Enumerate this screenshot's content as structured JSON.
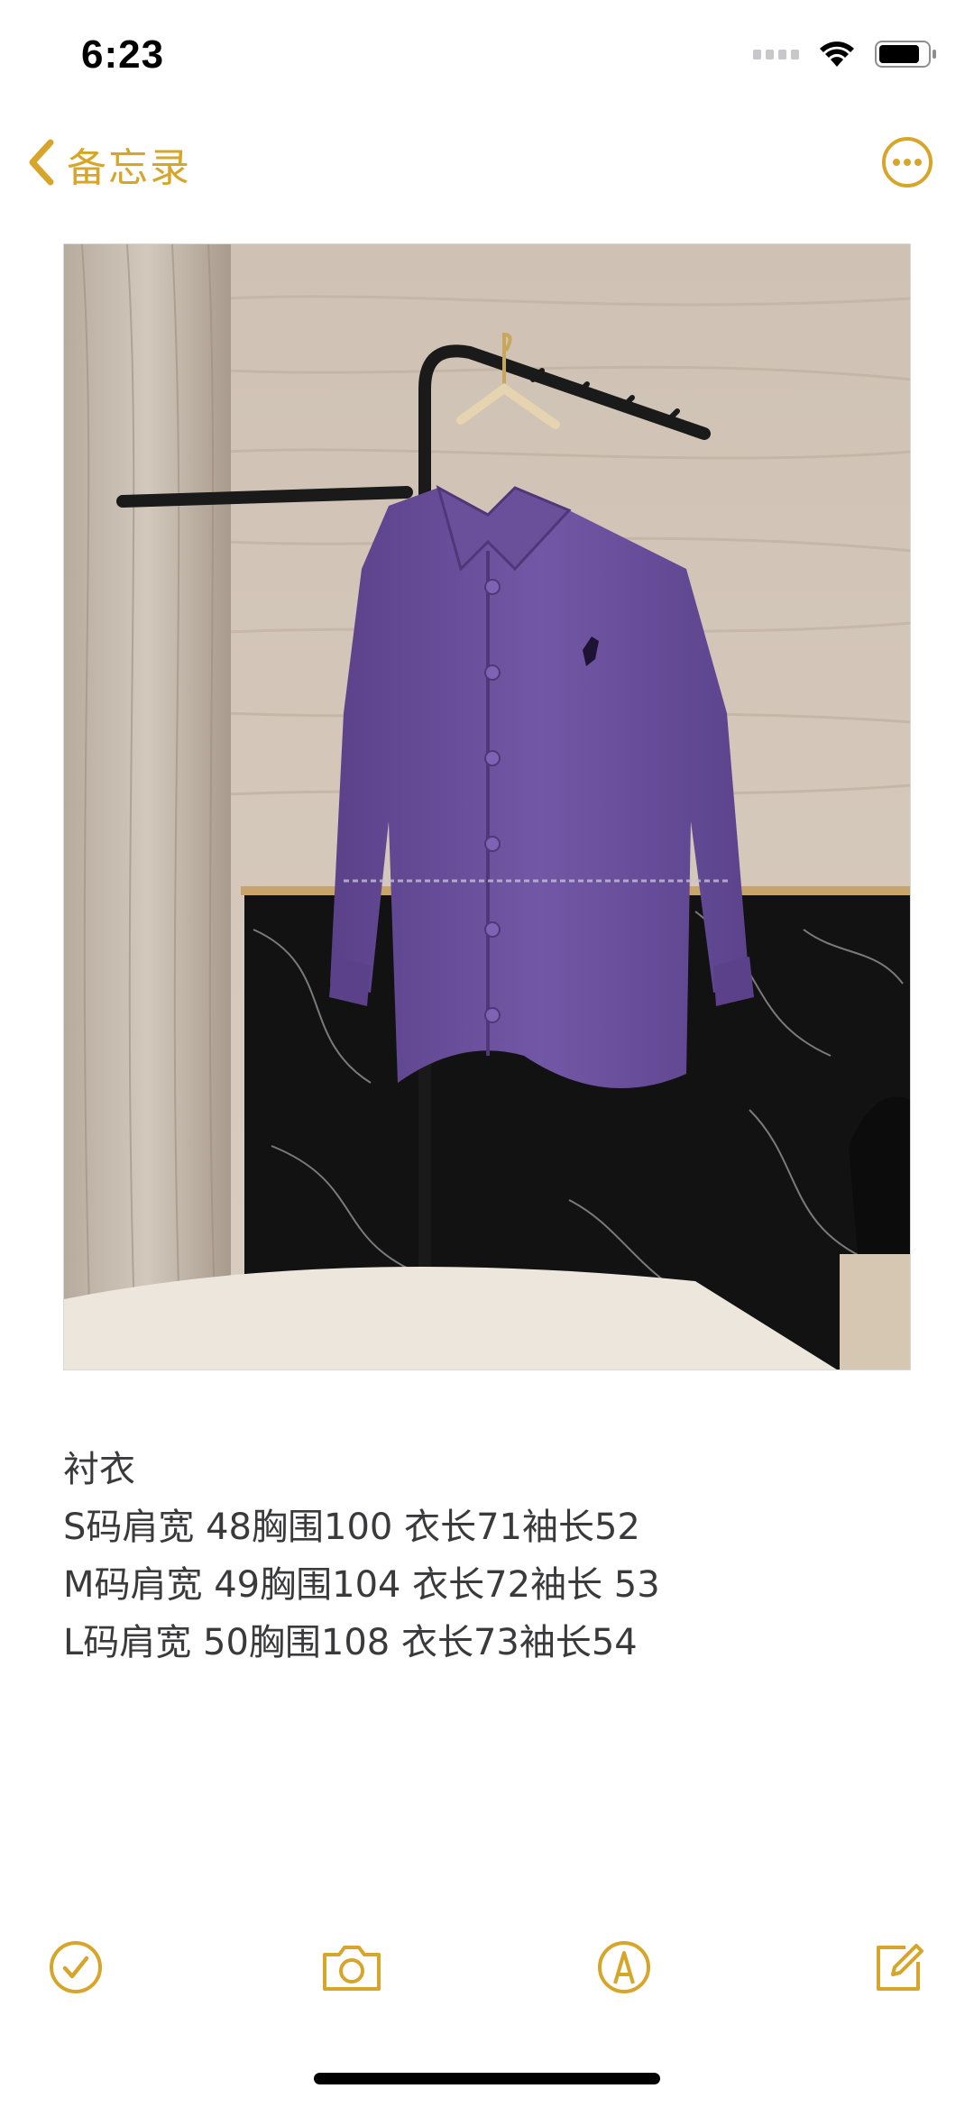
{
  "status_bar": {
    "time": "6:23"
  },
  "nav": {
    "back_label": "备忘录"
  },
  "note": {
    "lines": [
      "衬衣",
      "S码肩宽 48胸围100 衣长71袖长52",
      "M码肩宽 49胸围104 衣长72袖长 53",
      "L码肩宽 50胸围108 衣长73袖长54"
    ]
  },
  "icons": {
    "back": "chevron-left-icon",
    "more": "ellipsis-circle-icon",
    "checklist": "checkmark-circle-icon",
    "camera": "camera-icon",
    "markup": "pen-circle-icon",
    "compose": "compose-icon"
  },
  "colors": {
    "accent": "#d6a52a",
    "text": "#3a3a3c",
    "shirt": "#6b4f9c"
  }
}
